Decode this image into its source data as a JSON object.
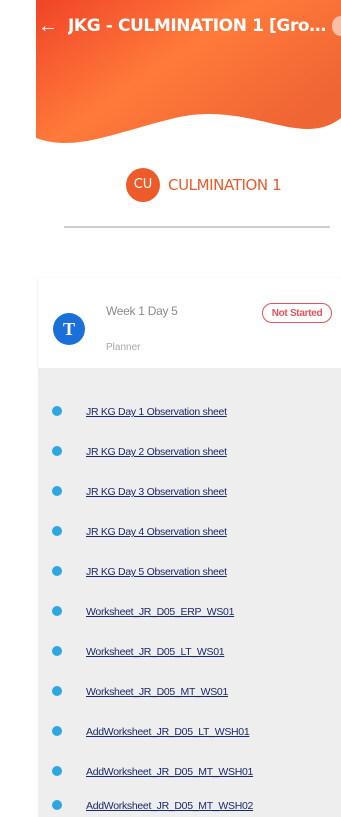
{
  "header": {
    "title": "JKG - CULMINATION 1 [Grou...",
    "gradient_colors": [
      "#ee3b24",
      "#ff7a3a",
      "#f06534"
    ]
  },
  "course": {
    "badge": "CU",
    "name": "CULMINATION 1"
  },
  "session": {
    "avatar_letter": "T",
    "title": "Week 1 Day 5",
    "subtitle": "Planner",
    "status": "Not Started",
    "status_color": "#e2555d"
  },
  "items": [
    {
      "label": "JR KG Day 1 Observation sheet"
    },
    {
      "label": "JR KG Day 2 Observation sheet"
    },
    {
      "label": "JR KG Day 3 Observation sheet"
    },
    {
      "label": "JR KG Day 4 Observation sheet"
    },
    {
      "label": "JR KG Day 5 Observation sheet"
    },
    {
      "label": "Worksheet_JR_D05_ERP_WS01"
    },
    {
      "label": "Worksheet_JR_D05_LT_WS01"
    },
    {
      "label": "Worksheet_JR_D05_MT_WS01"
    },
    {
      "label": "AddWorksheet_JR_D05_LT_WSH01"
    },
    {
      "label": "AddWorksheet_JR_D05_MT_WSH01"
    },
    {
      "label": "AddWorksheet_JR_D05_MT_WSH02"
    }
  ]
}
